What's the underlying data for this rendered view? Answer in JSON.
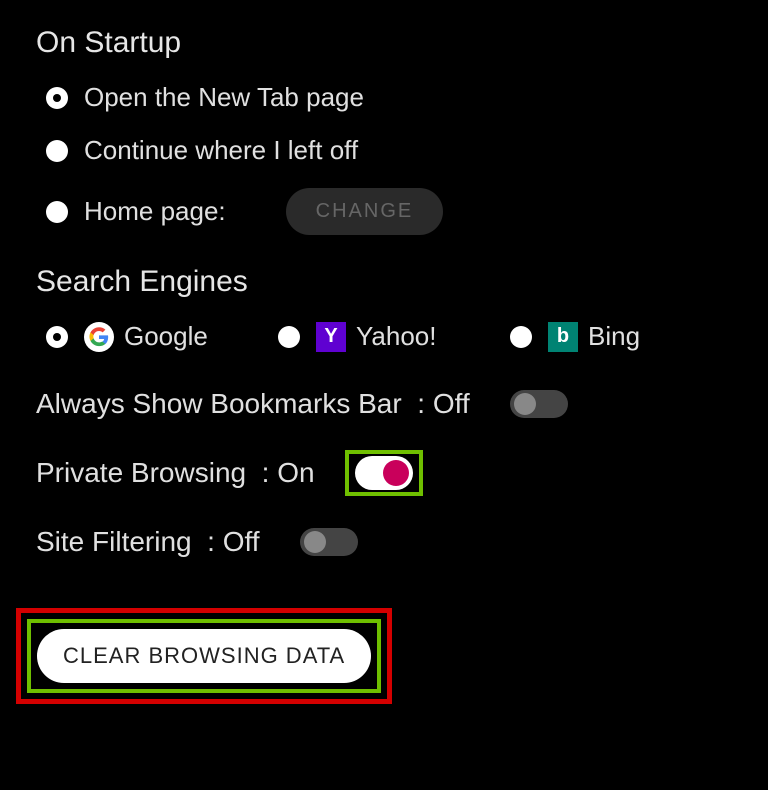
{
  "startup": {
    "heading": "On Startup",
    "options": [
      "Open the New Tab page",
      "Continue where I left off",
      "Home page:"
    ],
    "selected": 0,
    "change_label": "CHANGE"
  },
  "search": {
    "heading": "Search Engines",
    "engines": [
      "Google",
      "Yahoo!",
      "Bing"
    ],
    "selected": 0
  },
  "toggles": {
    "bookmarks": {
      "label": "Always Show Bookmarks Bar",
      "state_text": "Off",
      "on": false
    },
    "private": {
      "label": "Private Browsing",
      "state_text": "On",
      "on": true
    },
    "filter": {
      "label": "Site Filtering",
      "state_text": "Off",
      "on": false
    }
  },
  "clear_label": "CLEAR BROWSING DATA"
}
